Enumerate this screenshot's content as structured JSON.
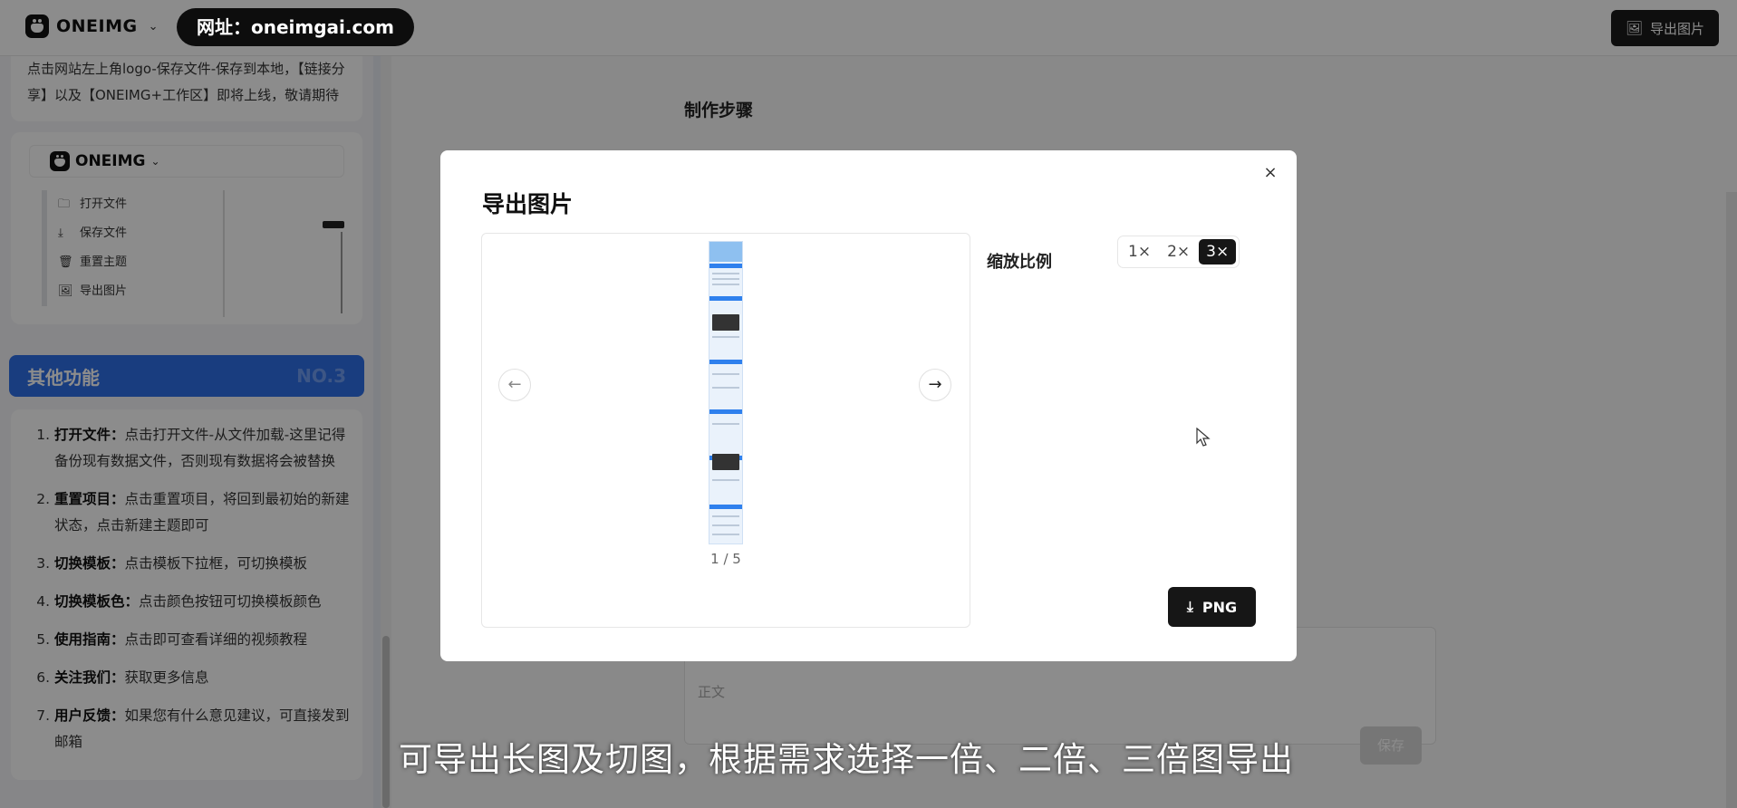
{
  "header": {
    "brand": "ONEIMG",
    "url_pill": "网址：oneimgai.com",
    "export_button": "导出图片"
  },
  "sidebar": {
    "intro_text": "点击网站左上角logo-保存文件-保存到本地，【链接分享】以及【ONEIMG+工作区】即将上线，敬请期待",
    "mini_app": {
      "brand": "ONEIMG",
      "menu": [
        "打开文件",
        "保存文件",
        "重置主题",
        "导出图片"
      ]
    },
    "section": {
      "title": "其他功能",
      "number": "NO.3"
    },
    "features": [
      {
        "title": "打开文件：",
        "text": "点击打开文件-从文件加载-这里记得备份现有数据文件，否则现有数据将会被替换"
      },
      {
        "title": "重置项目：",
        "text": "点击重置项目，将回到最初始的新建状态，点击新建主题即可"
      },
      {
        "title": "切换模板：",
        "text": "点击模板下拉框，可切换模板"
      },
      {
        "title": "切换模板色：",
        "text": "点击颜色按钮可切换模板颜色"
      },
      {
        "title": "使用指南：",
        "text": "点击即可查看详细的视频教程"
      },
      {
        "title": "关注我们：",
        "text": "获取更多信息"
      },
      {
        "title": "用户反馈：",
        "text": "如果您有什么意见建议，可直接发到邮箱"
      }
    ]
  },
  "main": {
    "steps_title": "制作步骤",
    "body_placeholder": "正文",
    "save_label": "保存"
  },
  "modal": {
    "title": "导出图片",
    "close_icon": "×",
    "page_counter": "1 / 5",
    "scale_label": "缩放比例",
    "scale_options": [
      "1×",
      "2×",
      "3×"
    ],
    "scale_selected": "3×",
    "download_label": "PNG"
  },
  "subtitle": "可导出长图及切图，根据需求选择一倍、二倍、三倍图导出"
}
